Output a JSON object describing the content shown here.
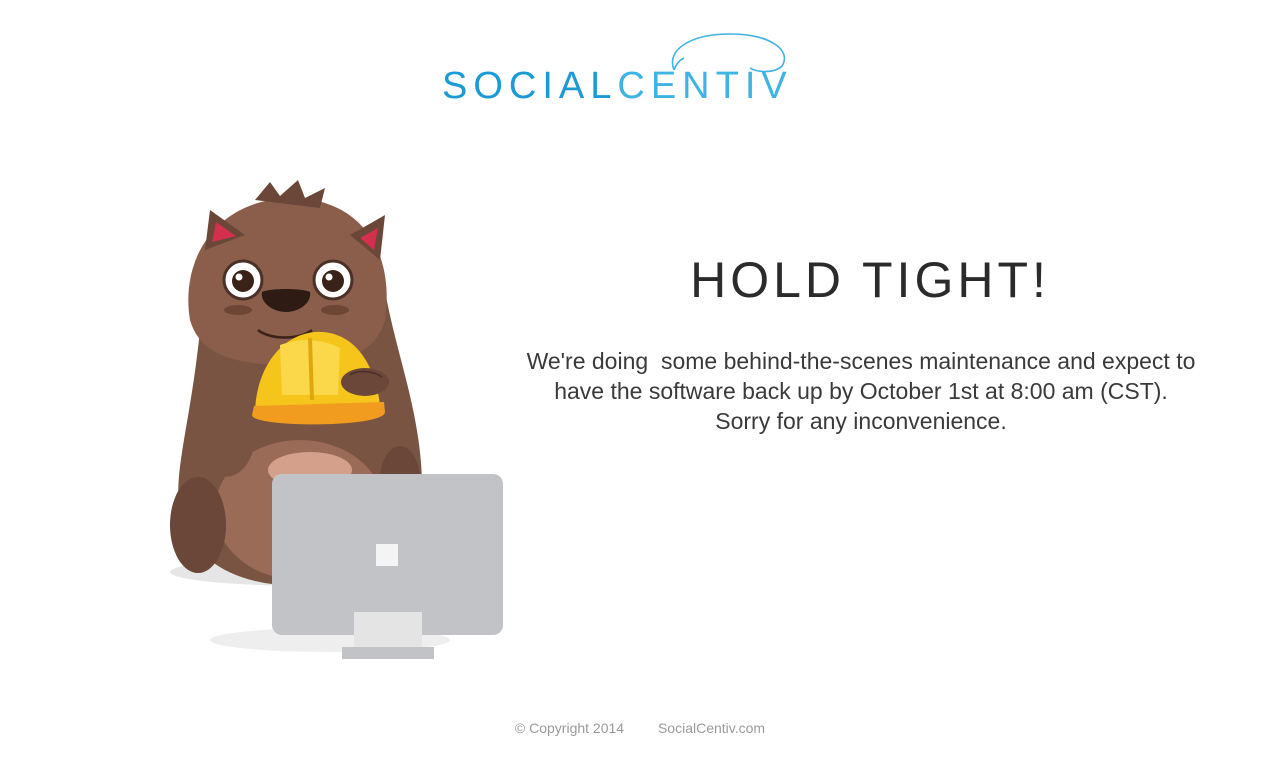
{
  "brand": {
    "logo_part1": "SOCIAL",
    "logo_part2": "CENTIV",
    "colors": {
      "primary": "#1b9ad6",
      "secondary": "#3fb3e2"
    }
  },
  "mascot": {
    "icon": "wombat-with-hard-hat-icon",
    "monitor_icon": "computer-monitor-icon"
  },
  "main": {
    "headline": "HOLD TIGHT!",
    "message_lines": [
      "We're doing  some behind-the-scenes maintenance and expect to",
      "have the software back up by October 1st at 8:00 am (CST).",
      "Sorry for any inconvenience."
    ]
  },
  "footer": {
    "copyright": "© Copyright 2014",
    "site_link": "SocialCentiv.com"
  }
}
